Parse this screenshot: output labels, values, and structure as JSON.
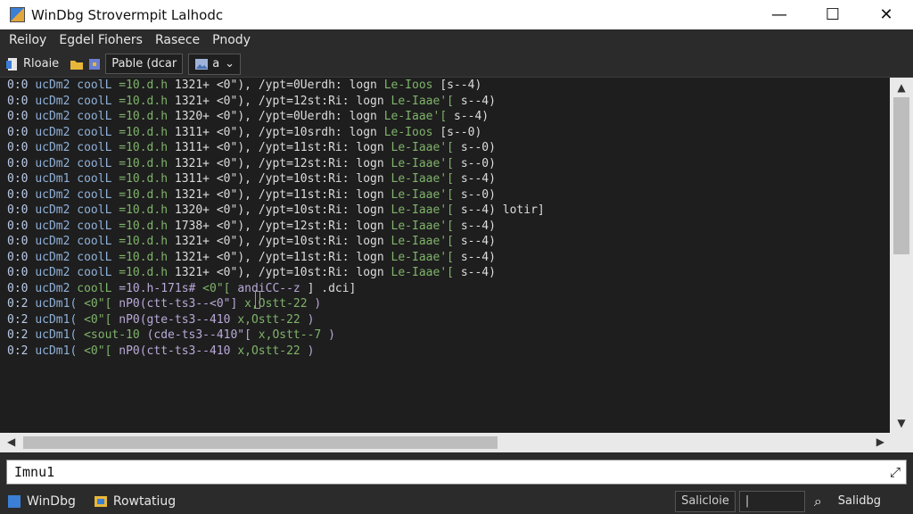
{
  "window": {
    "title": "WinDbg Strovermpit Lalhodc",
    "controls": [
      "—",
      "☐",
      "✕"
    ]
  },
  "menu": [
    "Reiloy",
    "Egdel Fiohers",
    "Rasece",
    "Pnody"
  ],
  "toolbar": {
    "open_label": "Rloaie",
    "box_label": "Pable (dcar",
    "dropdown_label": "a"
  },
  "output_lines": [
    [
      "0:0",
      "ucDm2",
      "coolL",
      "=10.d.h",
      "1321+",
      "<0\"),",
      "/ypt=0Uerdh:",
      "logn",
      "Le-Ioos",
      "[s--4)"
    ],
    [
      "0:0",
      "ucDm2",
      "coolL",
      "=10.d.h",
      "1321+",
      "<0\"),",
      "/ypt=12st:Ri:",
      "logn",
      "Le-Iaae'[",
      "s--4)"
    ],
    [
      "0:0",
      "ucDm2",
      "coolL",
      "=10.d.h",
      "1320+",
      "<0\"),",
      "/ypt=0Uerdh:",
      "logn",
      "Le-Iaae'[",
      "s--4)"
    ],
    [
      "0:0",
      "ucDm2",
      "coolL",
      "=10.d.h",
      "1311+",
      "<0\"),",
      "/ypt=10srdh:",
      "logn",
      "Le-Ioos",
      "[s--0)"
    ],
    [
      "0:0",
      "ucDm2",
      "coolL",
      "=10.d.h",
      "1311+",
      "<0\"),",
      "/ypt=11st:Ri:",
      "logn",
      "Le-Iaae'[",
      "s--0)"
    ],
    [
      "0:0",
      "ucDm2",
      "coolL",
      "=10.d.h",
      "1321+",
      "<0\"),",
      "/ypt=12st:Ri:",
      "logn",
      "Le-Iaae'[",
      "s--0)"
    ],
    [
      "0:0",
      "ucDm1",
      "coolL",
      "=10.d.h",
      "1311+",
      "<0\"),",
      "/ypt=10st:Ri:",
      "logn",
      "Le-Iaae'[",
      "s--4)"
    ],
    [
      "0:0",
      "ucDm2",
      "coolL",
      "=10.d.h",
      "1321+",
      "<0\"),",
      "/ypt=11st:Ri:",
      "logn",
      "Le-Iaae'[",
      "s--0)"
    ],
    [
      "0:0",
      "ucDm2",
      "coolL",
      "=10.d.h",
      "1320+",
      "<0\"),",
      "/ypt=10st:Ri:",
      "logn",
      "Le-Iaae'[",
      "s--4) lotir]"
    ],
    [
      "0:0",
      "ucDm2",
      "coolL",
      "=10.d.h",
      "1738+",
      "<0\"),",
      "/ypt=12st:Ri:",
      "logn",
      "Le-Iaae'[",
      "s--4)"
    ],
    [
      "0:0",
      "ucDm2",
      "coolL",
      "=10.d.h",
      "1321+",
      "<0\"),",
      "/ypt=10st:Ri:",
      "logn",
      "Le-Iaae'[",
      "s--4)"
    ],
    [
      "0:0",
      "ucDm2",
      "coolL",
      "=10.d.h",
      "1321+",
      "<0\"),",
      "/ypt=11st:Ri:",
      "logn",
      "Le-Iaae'[",
      "s--4)"
    ],
    [
      "0:0",
      "ucDm2",
      "coolL",
      "=10.d.h",
      "1321+",
      "<0\"),",
      "/ypt=10st:Ri:",
      "logn",
      "Le-Iaae'[",
      "s--4)"
    ]
  ],
  "output_lines_b": [
    [
      "0:0",
      "ucDm2",
      "coolL",
      "=10.h-171s#",
      "<0\"[",
      "andiCC--z",
      "] .dci]"
    ],
    [
      "0:2",
      "ucDm1(",
      "<0\"[",
      "nP0(ctt-ts3--<0\"]",
      "x,Ostt-22",
      ")"
    ],
    [
      "0:2",
      "ucDm1(",
      "<0\"[",
      "nP0(gte-ts3--410",
      "x,Ostt-22",
      ")"
    ],
    [
      "0:2",
      "ucDm1(",
      "<sout-10",
      "(cde-ts3--410\"[",
      "x,Ostt--7",
      ")"
    ],
    [
      "0:2",
      "ucDm1(",
      "<0\"[",
      "nP0(ctt-ts3--410",
      "x,Ostt-22",
      ")"
    ]
  ],
  "command": {
    "value": "Imnu1"
  },
  "status": {
    "app_label": "WinDbg",
    "task_label": "Rowtatiug",
    "field1": "Salicloie",
    "field2": "|",
    "field3": "Salidbg"
  },
  "scroll": {
    "vertical_position": 0.05,
    "horizontal_position": 0.0
  },
  "colors": {
    "accent": "#7fb36a",
    "background": "#1e1e1e"
  }
}
